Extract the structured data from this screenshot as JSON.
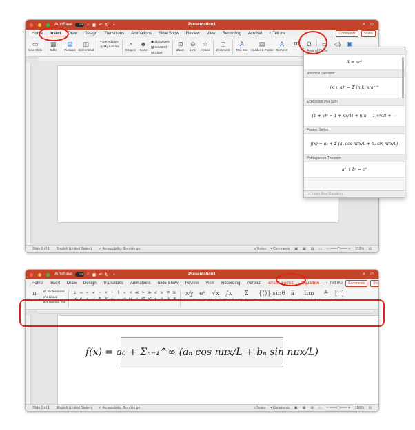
{
  "window_title": "Presentation1",
  "autosave_label": "AutoSave",
  "autosave_state": "OFF",
  "tabs_top": [
    "Home",
    "Insert",
    "Draw",
    "Design",
    "Transitions",
    "Animations",
    "Slide Show",
    "Review",
    "View",
    "Recording",
    "Acrobat"
  ],
  "tabs_bottom": [
    "Home",
    "Insert",
    "Draw",
    "Design",
    "Transitions",
    "Animations",
    "Slide Show",
    "Review",
    "View",
    "Recording",
    "Acrobat",
    "Shape Format",
    "Equation"
  ],
  "tell_me": "Tell me",
  "comments_label": "Comments",
  "share_label": "Share",
  "insert_ribbon": {
    "new_slide": "New Slide",
    "table": "Table",
    "pictures": "Pictures",
    "screenshot": "Screenshot",
    "get_addins": "Get Add-ins",
    "my_addins": "My Add-ins",
    "shapes": "Shapes",
    "icons": "Icons",
    "models3d": "3D Models",
    "smartart": "SmartArt",
    "chart": "Chart",
    "zoom": "Zoom",
    "link": "Link",
    "action": "Action",
    "comment": "Comment",
    "textbox": "Text Box",
    "header_footer": "Header & Footer",
    "wordart": "WordArt"
  },
  "equation_ribbon": {
    "equation": "Equation",
    "professional": "Professional",
    "linear": "Linear",
    "normal_text": "Normal Text",
    "symbols_row1": [
      "±",
      "∞",
      "=",
      "≠",
      "~",
      "×",
      "÷",
      "!",
      "∝",
      "<",
      "≪",
      ">",
      "≫",
      "≤",
      "≥",
      "∓",
      "≅"
    ],
    "symbols_row2": [
      "∀",
      "∁",
      "∂",
      "√",
      "∛",
      "∜",
      "∪",
      "∩",
      "∅",
      "%",
      "°",
      "℉",
      "℃",
      "∆",
      "∇",
      "∃",
      "∄"
    ],
    "structures": [
      "Fraction",
      "Script",
      "Radical",
      "Integral",
      "Large Operator",
      "Bracket",
      "Function",
      "Accent",
      "Limit and Log",
      "Operator",
      "Matrix"
    ]
  },
  "dropdown": {
    "first_label": "Area of Circle",
    "items": [
      {
        "label": "Binomial Theorem",
        "formula": "(x + a)ⁿ = Σ (n k) xᵏaⁿ⁻ᵏ"
      },
      {
        "label": "Expansion of a Sum",
        "formula": "(1 + x)ⁿ = 1 + nx/1! + n(n − 1)x²/2! + ⋯"
      },
      {
        "label": "Fourier Series",
        "formula": "f(x) = a₀ + Σ (aₙ cos nπx/L + bₙ sin nπx/L)"
      },
      {
        "label": "Pythagorean Theorem",
        "formula": "a² + b² = c²"
      }
    ],
    "area_formula": "A = πr²",
    "insert_new": "Insert New Equation"
  },
  "equation_text": "f(x) = a₀ + Σₙ₌₁^∞ (aₙ cos nπx/L + bₙ sin nπx/L)",
  "status": {
    "slide": "Slide 1 of 1",
    "language": "English (United States)",
    "accessibility": "Accessibility: Good to go",
    "notes": "Notes",
    "comments": "Comments",
    "zoom_top": "113%",
    "zoom_bottom": "180%"
  },
  "colors": {
    "accent": "#c4442b",
    "highlight": "#e0231b"
  }
}
